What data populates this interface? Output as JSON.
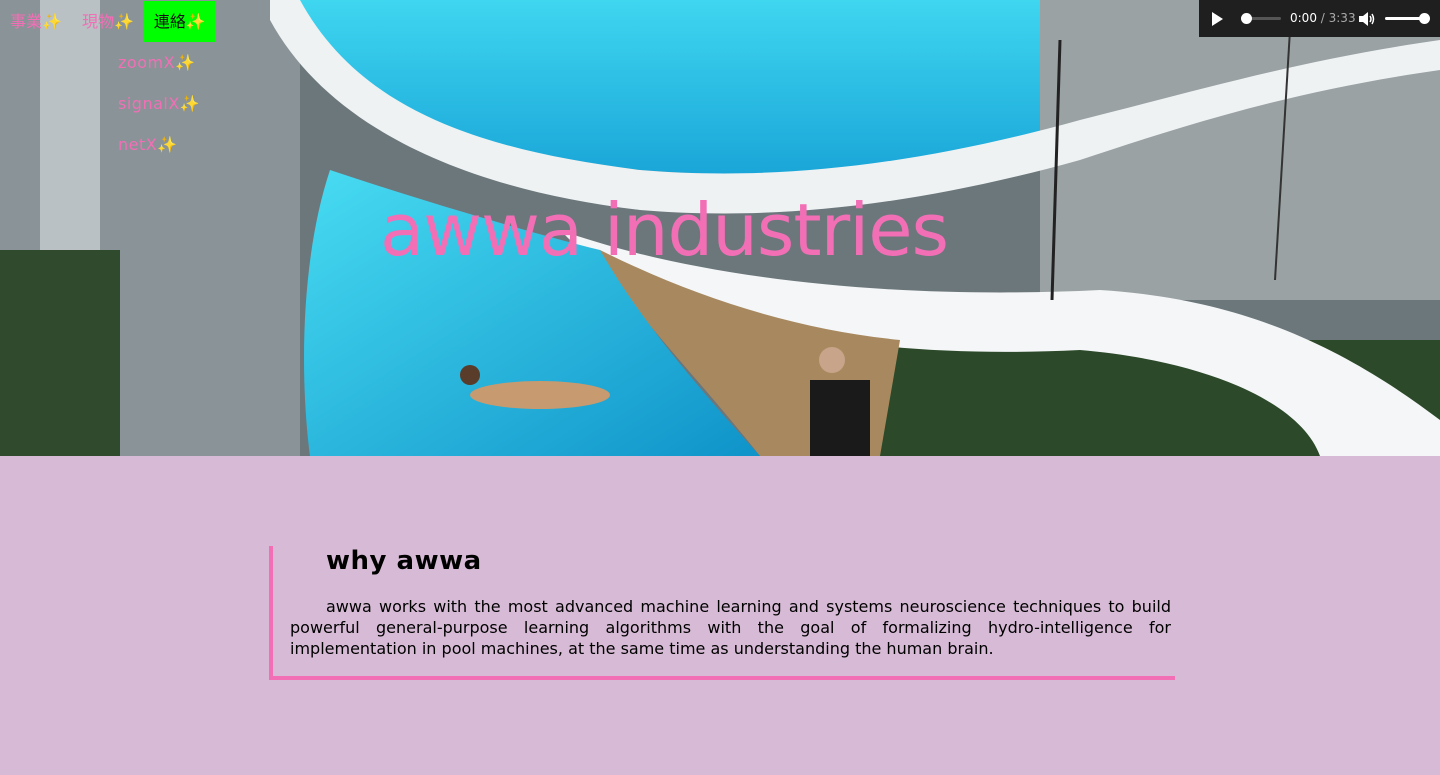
{
  "nav": {
    "items": [
      {
        "label": "事業✨"
      },
      {
        "label": "現物✨"
      },
      {
        "label": "連絡✨"
      }
    ],
    "active_index": 2,
    "submenu": [
      {
        "label": "zoomX✨"
      },
      {
        "label": "signalX✨"
      },
      {
        "label": "netX✨"
      }
    ]
  },
  "hero": {
    "title": "awwa industries",
    "image_icon": "pool-photo"
  },
  "player": {
    "current_time": "0:00",
    "separator": " / ",
    "duration": "3:33",
    "volume": 1.0,
    "progress": 0.0
  },
  "about": {
    "heading": "why awwa",
    "body": "awwa works with the most advanced machine learning and systems neuroscience techniques to build powerful general-purpose learning algorithms with the goal of formalizing hydro-intelligence for implementation in pool machines, at the same time as understanding the human brain."
  },
  "colors": {
    "accent": "#f26fb6",
    "active_nav_bg": "#00ff00",
    "page_bg": "#d7bbd6",
    "player_bg": "#1f1f1f"
  }
}
